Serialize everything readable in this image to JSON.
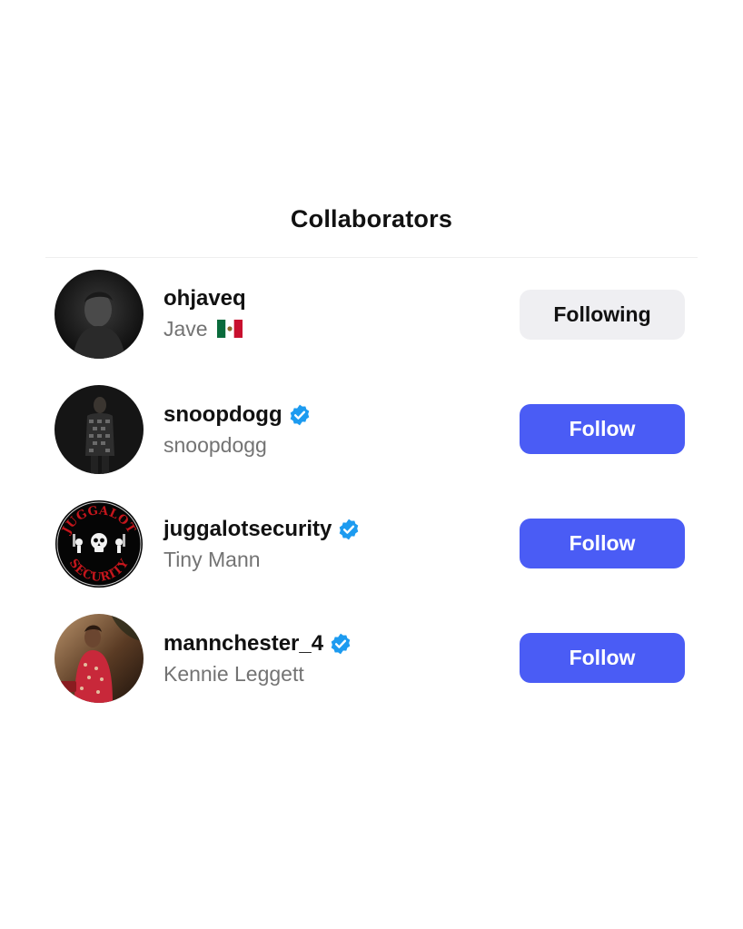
{
  "sheet": {
    "title": "Collaborators"
  },
  "colors": {
    "follow_button": "#4a5cf5",
    "following_button": "#efeff2",
    "verified_badge": "#1d9bf0",
    "secondary_text": "#737373"
  },
  "collaborators": [
    {
      "username": "ohjaveq",
      "full_name": "Jave",
      "flag_icon": "mexico-flag-icon",
      "verified": false,
      "button_label": "Following",
      "button_state": "following"
    },
    {
      "username": "snoopdogg",
      "full_name": "snoopdogg",
      "verified": true,
      "button_label": "Follow",
      "button_state": "follow"
    },
    {
      "username": "juggalotsecurity",
      "full_name": "Tiny Mann",
      "verified": true,
      "button_label": "Follow",
      "button_state": "follow",
      "avatar_logo_text": [
        "JUGGALOT",
        "SECURITY"
      ]
    },
    {
      "username": "mannchester_4",
      "full_name": "Kennie Leggett",
      "verified": true,
      "button_label": "Follow",
      "button_state": "follow"
    }
  ]
}
